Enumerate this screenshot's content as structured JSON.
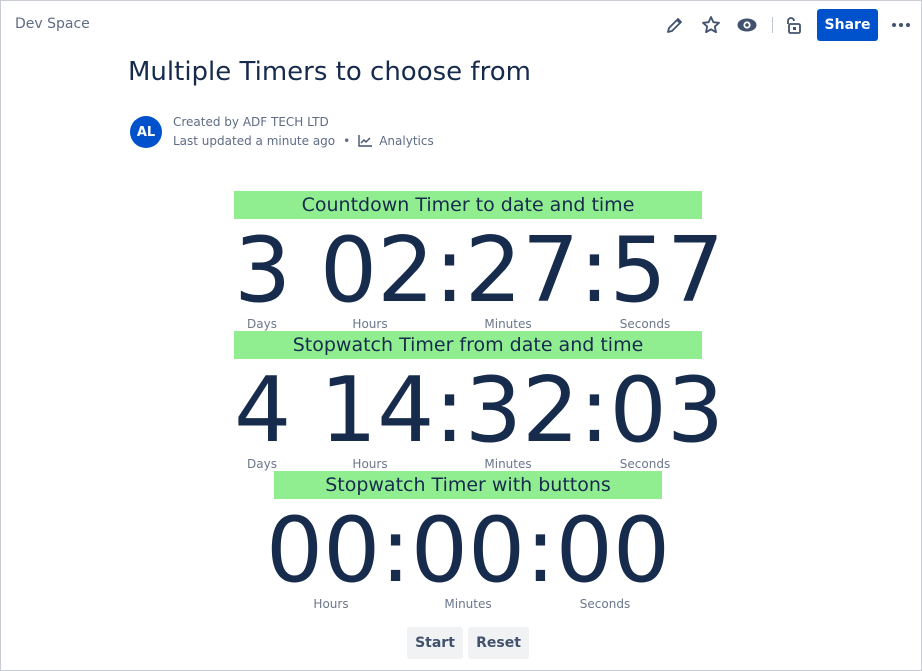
{
  "header": {
    "space_name": "Dev Space",
    "share_label": "Share",
    "icons": [
      "edit-icon",
      "star-icon",
      "watch-icon",
      "restrictions-icon",
      "more-icon"
    ]
  },
  "page": {
    "title": "Multiple Timers to choose from",
    "avatar_initials": "AL",
    "created_by": "Created by ADF TECH LTD",
    "last_updated": "Last updated a minute ago",
    "separator": "•",
    "analytics_label": "Analytics"
  },
  "timers": {
    "countdown": {
      "heading": "Countdown Timer to date and time",
      "display": "3 02:27:57",
      "labels": {
        "days": "Days",
        "hours": "Hours",
        "minutes": "Minutes",
        "seconds": "Seconds"
      }
    },
    "stopwatch_date": {
      "heading": "Stopwatch Timer from date and time",
      "display": "4 14:32:03",
      "labels": {
        "days": "Days",
        "hours": "Hours",
        "minutes": "Minutes",
        "seconds": "Seconds"
      }
    },
    "stopwatch_buttons": {
      "heading": "Stopwatch Timer with buttons",
      "display": "00:00:00",
      "labels": {
        "hours": "Hours",
        "minutes": "Minutes",
        "seconds": "Seconds"
      },
      "start_label": "Start",
      "reset_label": "Reset"
    }
  },
  "colors": {
    "accent": "#0052CC",
    "heading_bg": "#90EE90",
    "text": "#172B4D"
  }
}
